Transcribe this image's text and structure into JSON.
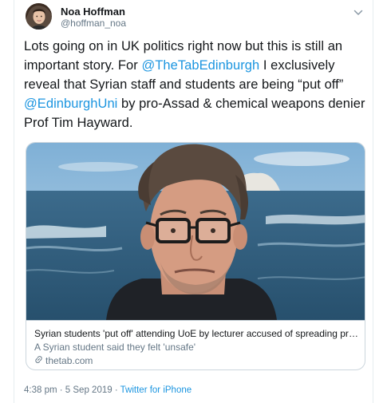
{
  "author": {
    "display_name": "Noa Hoffman",
    "handle": "@hoffman_noa"
  },
  "tweet": {
    "text_1": "Lots going on in UK politics right now but this is still an important story. For ",
    "mention_1": "@TheTabEdinburgh",
    "text_2": " I exclusively reveal that Syrian staff and students are being “put off” ",
    "mention_2": "@EdinburghUni",
    "text_3": " by pro-Assad & chemical weapons denier Prof Tim Hayward."
  },
  "card": {
    "title": "Syrian students 'put off' attending UoE by lecturer accused of spreading pro-Assad propaganda",
    "description": "A Syrian student said they felt 'unsafe'",
    "domain": "thetab.com"
  },
  "meta": {
    "time": "4:38 pm",
    "separator": " · ",
    "date": "5 Sep 2019",
    "source": "Twitter for iPhone"
  },
  "icons": {
    "caret": "chevron-down-icon",
    "link": "link-icon"
  },
  "colors": {
    "link": "#1b95e0",
    "secondary_text": "#657786",
    "border": "#ccd6dd"
  }
}
